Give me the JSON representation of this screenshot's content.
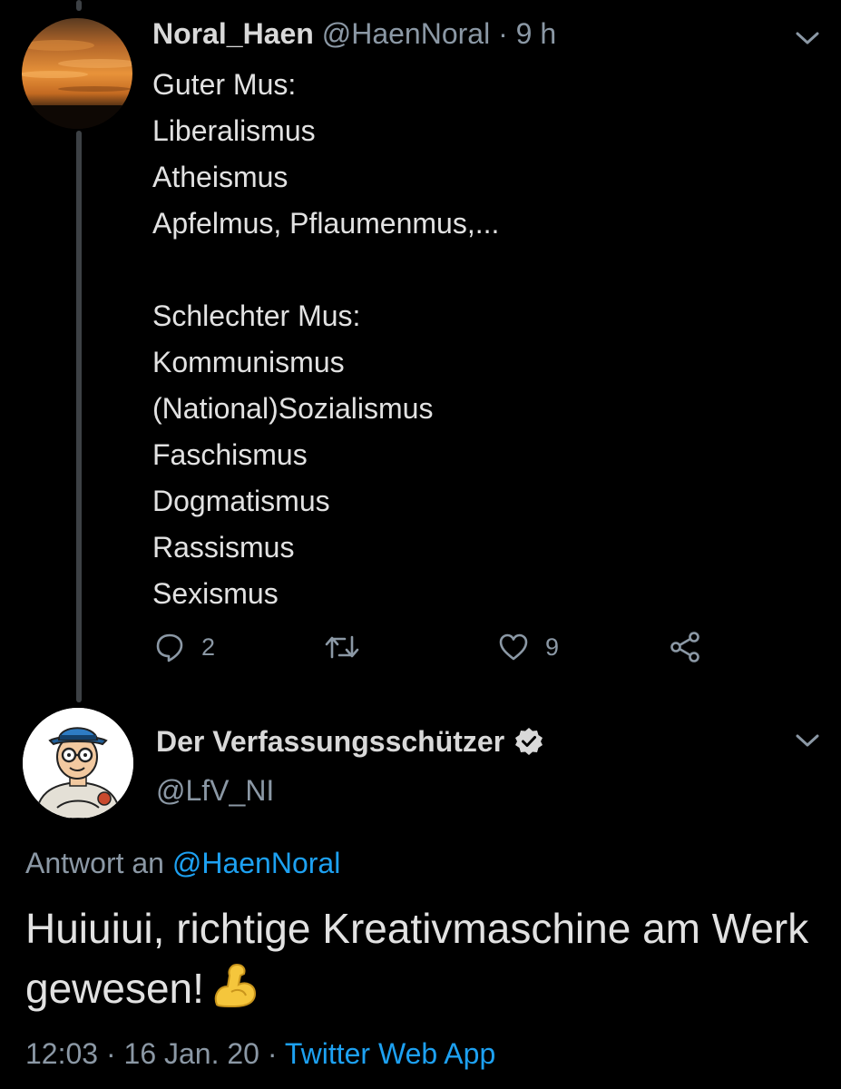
{
  "colors": {
    "background": "#000000",
    "text": "#d9d9d9",
    "muted": "#8b98a5",
    "link": "#1da1f2",
    "thread_line": "#3d4145"
  },
  "tweet1": {
    "display_name": "Noral_Haen",
    "handle": "@HaenNoral",
    "separator": " · ",
    "time": "9 h",
    "avatar_icon": "sunset-avatar",
    "lines": [
      "Guter Mus:",
      "Liberalismus",
      "Atheismus",
      "Apfelmus, Pflaumenmus,...",
      "",
      "Schlechter Mus:",
      "Kommunismus",
      "(National)Sozialismus",
      "Faschismus",
      "Dogmatismus",
      "Rassismus",
      "Sexismus"
    ],
    "actions": {
      "reply_icon": "reply-icon",
      "reply_count": "2",
      "retweet_icon": "retweet-icon",
      "like_icon": "heart-icon",
      "like_count": "9",
      "share_icon": "share-icon"
    }
  },
  "tweet2": {
    "display_name": "Der Verfassungsschützer",
    "verified_icon": "verified-badge-icon",
    "handle": "@LfV_NI",
    "avatar_icon": "mascot-avatar",
    "reply_prefix": "Antwort an ",
    "reply_to": "@HaenNoral",
    "text": "Huiuiui, richtige Kreativmaschine am Werk gewesen!",
    "emoji_icon": "flexed-biceps-emoji",
    "time": "12:03",
    "date": "16 Jan. 20",
    "separator": " · ",
    "source": "Twitter Web App"
  }
}
